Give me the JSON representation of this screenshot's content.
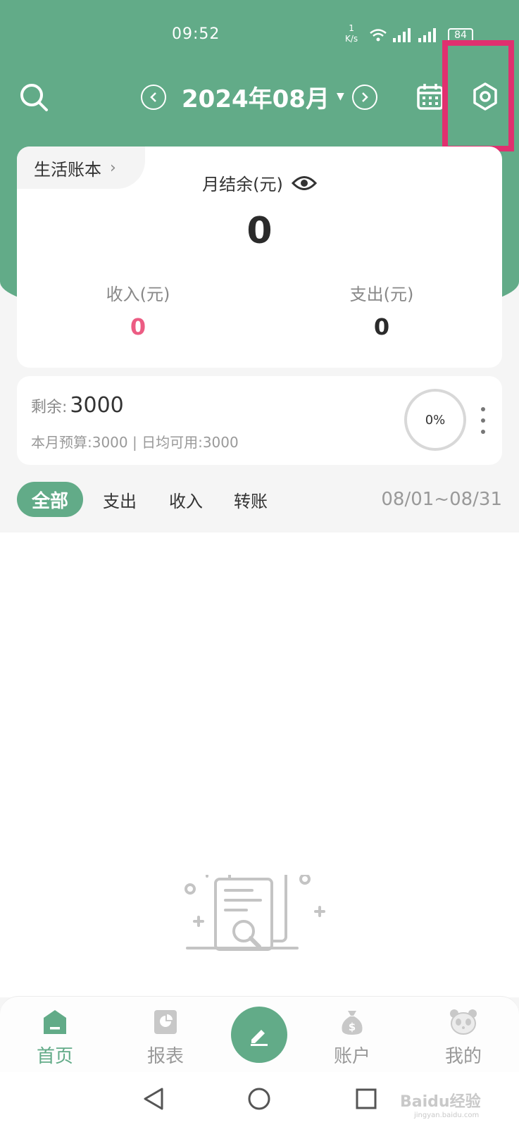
{
  "status_bar": {
    "time": "09:52",
    "net_speed_value": "1",
    "net_speed_unit": "K/s",
    "battery": "84"
  },
  "header": {
    "month_title": "2024年08月"
  },
  "summary": {
    "book_name": "生活账本",
    "balance_label": "月结余(元)",
    "balance_value": "0",
    "income_label": "收入(元)",
    "income_value": "0",
    "expense_label": "支出(元)",
    "expense_value": "0"
  },
  "budget": {
    "remain_label": "剩余:",
    "remain_value": "3000",
    "detail": "本月预算:3000 | 日均可用:3000",
    "progress": "0%"
  },
  "filters": {
    "tabs": [
      "全部",
      "支出",
      "收入",
      "转账"
    ],
    "active_index": 0,
    "date_range": "08/01~08/31"
  },
  "bottom_nav": {
    "items": [
      {
        "label": "首页",
        "icon": "home-icon"
      },
      {
        "label": "报表",
        "icon": "report-icon"
      },
      {
        "label": "",
        "icon": "edit-icon"
      },
      {
        "label": "账户",
        "icon": "money-bag-icon"
      },
      {
        "label": "我的",
        "icon": "panda-icon"
      }
    ]
  },
  "watermark": {
    "text": "Baidu经验",
    "url": "jingyan.baidu.com"
  },
  "colors": {
    "primary": "#62ab88",
    "income": "#ec5c83",
    "highlight": "#e0306f"
  }
}
